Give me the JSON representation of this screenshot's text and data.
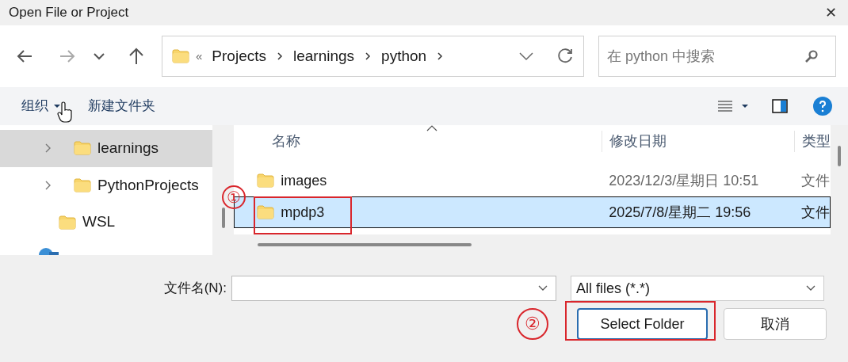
{
  "window": {
    "title": "Open File or Project",
    "close": "✕"
  },
  "address": {
    "overflow": "«",
    "crumbs": [
      "Projects",
      "learnings",
      "python"
    ]
  },
  "search": {
    "placeholder": "在 python 中搜索"
  },
  "toolbar": {
    "organize": "组织",
    "new_folder": "新建文件夹"
  },
  "sidebar": {
    "items": [
      {
        "label": "learnings",
        "expandable": true,
        "selected": true
      },
      {
        "label": "PythonProjects",
        "expandable": true,
        "selected": false
      },
      {
        "label": "WSL",
        "expandable": false,
        "selected": false
      }
    ]
  },
  "table": {
    "columns": [
      "名称",
      "修改日期",
      "类型"
    ],
    "rows": [
      {
        "name": "images",
        "modified": "2023/12/3/星期日 10:51",
        "type": "文件",
        "selected": false
      },
      {
        "name": "mpdp3",
        "modified": "2025/7/8/星期二 19:56",
        "type": "文件",
        "selected": true
      }
    ]
  },
  "filename": {
    "label": "文件名(N):"
  },
  "filter": {
    "value": "All files (*.*)"
  },
  "buttons": [
    {
      "label": "Select Folder",
      "kind": "primary"
    },
    {
      "label": "取消",
      "kind": "secondary"
    }
  ],
  "annotations": [
    "①",
    "②"
  ]
}
